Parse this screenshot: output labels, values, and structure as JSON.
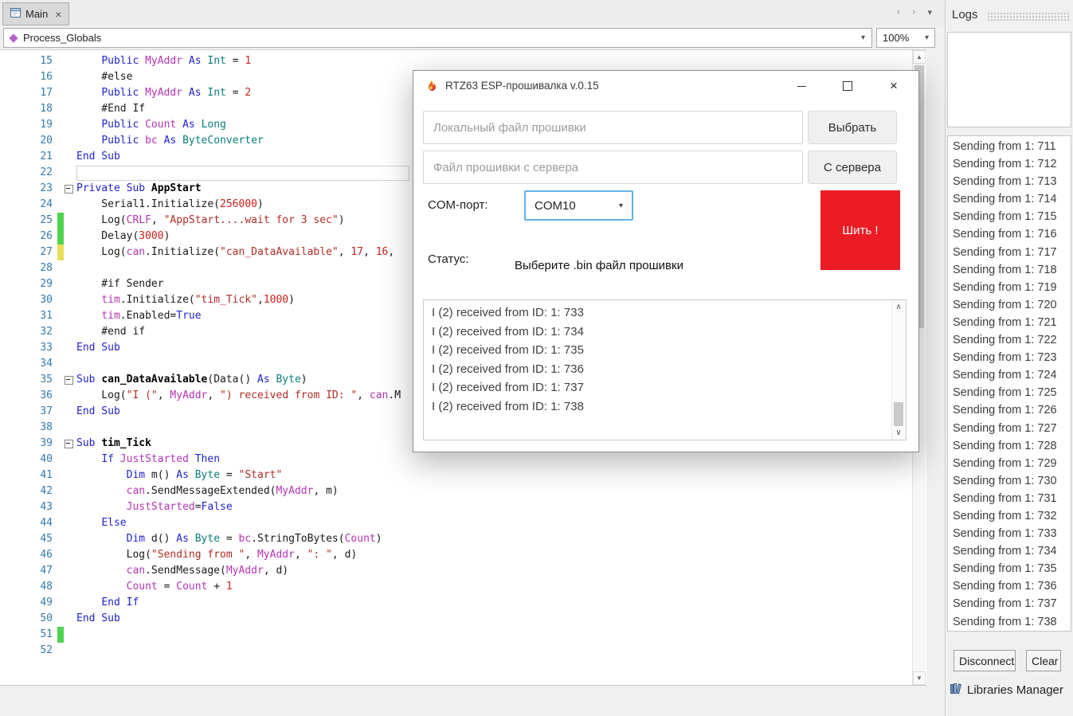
{
  "tab_bar": {
    "tab_label": "Main"
  },
  "toolbar": {
    "module_selector": "Process_Globals",
    "zoom": "100%"
  },
  "icons": {
    "tab_close": "×",
    "nav_left": "‹",
    "nav_right": "›",
    "nav_menu": "▾",
    "chevron_down": "▾",
    "scroll_up": "▲",
    "scroll_down": "▼",
    "list_up": "∧",
    "list_down": "∨",
    "dialog_close": "×"
  },
  "editor": {
    "lines": [
      {
        "n": 15,
        "seg": [
          [
            "    ",
            "p"
          ],
          [
            "Public",
            "k"
          ],
          [
            " ",
            "p"
          ],
          [
            "MyAddr",
            "m"
          ],
          [
            " ",
            "p"
          ],
          [
            "As",
            "k"
          ],
          [
            " ",
            "p"
          ],
          [
            "Int",
            "t"
          ],
          [
            " = ",
            "p"
          ],
          [
            "1",
            "n"
          ]
        ]
      },
      {
        "n": 16,
        "seg": [
          [
            "    #else",
            "p"
          ]
        ]
      },
      {
        "n": 17,
        "seg": [
          [
            "    ",
            "p"
          ],
          [
            "Public",
            "k"
          ],
          [
            " ",
            "p"
          ],
          [
            "MyAddr",
            "m"
          ],
          [
            " ",
            "p"
          ],
          [
            "As",
            "k"
          ],
          [
            " ",
            "p"
          ],
          [
            "Int",
            "t"
          ],
          [
            " = ",
            "p"
          ],
          [
            "2",
            "n"
          ]
        ]
      },
      {
        "n": 18,
        "seg": [
          [
            "    #End If",
            "p"
          ]
        ]
      },
      {
        "n": 19,
        "seg": [
          [
            "    ",
            "p"
          ],
          [
            "Public",
            "k"
          ],
          [
            " ",
            "p"
          ],
          [
            "Count",
            "m"
          ],
          [
            " ",
            "p"
          ],
          [
            "As",
            "k"
          ],
          [
            " ",
            "p"
          ],
          [
            "Long",
            "t"
          ]
        ]
      },
      {
        "n": 20,
        "seg": [
          [
            "    ",
            "p"
          ],
          [
            "Public",
            "k"
          ],
          [
            " ",
            "p"
          ],
          [
            "bc",
            "m"
          ],
          [
            " ",
            "p"
          ],
          [
            "As",
            "k"
          ],
          [
            " ",
            "p"
          ],
          [
            "ByteConverter",
            "t"
          ]
        ]
      },
      {
        "n": 21,
        "seg": [
          [
            "End Sub",
            "k"
          ]
        ]
      },
      {
        "n": 22,
        "active": true,
        "seg": []
      },
      {
        "n": 23,
        "fold": true,
        "seg": [
          [
            "Private Sub",
            "k"
          ],
          [
            " ",
            "p"
          ],
          [
            "AppStart",
            "b"
          ]
        ]
      },
      {
        "n": 24,
        "seg": [
          [
            "    Serial1.Initialize(",
            "p"
          ],
          [
            "256000",
            "n"
          ],
          [
            ")",
            "p"
          ]
        ]
      },
      {
        "n": 25,
        "mark": "g",
        "seg": [
          [
            "    Log(",
            "p"
          ],
          [
            "CRLF",
            "m"
          ],
          [
            ", ",
            "p"
          ],
          [
            "\"AppStart....wait for 3 sec\"",
            "s"
          ],
          [
            ")",
            "p"
          ]
        ]
      },
      {
        "n": 26,
        "mark": "g",
        "seg": [
          [
            "    Delay(",
            "p"
          ],
          [
            "3000",
            "n"
          ],
          [
            ")",
            "p"
          ]
        ]
      },
      {
        "n": 27,
        "mark": "y",
        "seg": [
          [
            "    Log(",
            "p"
          ],
          [
            "can",
            "m"
          ],
          [
            ".Initialize(",
            "p"
          ],
          [
            "\"can_DataAvailable\"",
            "s"
          ],
          [
            ", ",
            "p"
          ],
          [
            "17",
            "n"
          ],
          [
            ", ",
            "p"
          ],
          [
            "16",
            "n"
          ],
          [
            ", ",
            "p"
          ]
        ]
      },
      {
        "n": 28,
        "seg": []
      },
      {
        "n": 29,
        "seg": [
          [
            "    #if Sender",
            "p"
          ]
        ]
      },
      {
        "n": 30,
        "seg": [
          [
            "    ",
            "p"
          ],
          [
            "tim",
            "m"
          ],
          [
            ".Initialize(",
            "p"
          ],
          [
            "\"tim_Tick\"",
            "s"
          ],
          [
            ",",
            "p"
          ],
          [
            "1000",
            "n"
          ],
          [
            ")",
            "p"
          ]
        ]
      },
      {
        "n": 31,
        "seg": [
          [
            "    ",
            "p"
          ],
          [
            "tim",
            "m"
          ],
          [
            ".Enabled=",
            "p"
          ],
          [
            "True",
            "k"
          ]
        ]
      },
      {
        "n": 32,
        "seg": [
          [
            "    #end if",
            "p"
          ]
        ]
      },
      {
        "n": 33,
        "seg": [
          [
            "End Sub",
            "k"
          ]
        ]
      },
      {
        "n": 34,
        "seg": []
      },
      {
        "n": 35,
        "fold": true,
        "seg": [
          [
            "Sub",
            "k"
          ],
          [
            " ",
            "p"
          ],
          [
            "can_DataAvailable",
            "b"
          ],
          [
            "(Data() ",
            "p"
          ],
          [
            "As",
            "k"
          ],
          [
            " ",
            "p"
          ],
          [
            "Byte",
            "t"
          ],
          [
            ")",
            "p"
          ]
        ]
      },
      {
        "n": 36,
        "seg": [
          [
            "    Log(",
            "p"
          ],
          [
            "\"I (\"",
            "s"
          ],
          [
            ", ",
            "p"
          ],
          [
            "MyAddr",
            "m"
          ],
          [
            ", ",
            "p"
          ],
          [
            "\") received from ID: \"",
            "s"
          ],
          [
            ", ",
            "p"
          ],
          [
            "can",
            "m"
          ],
          [
            ".M",
            "p"
          ]
        ]
      },
      {
        "n": 37,
        "seg": [
          [
            "End Sub",
            "k"
          ]
        ]
      },
      {
        "n": 38,
        "seg": []
      },
      {
        "n": 39,
        "fold": true,
        "seg": [
          [
            "Sub",
            "k"
          ],
          [
            " ",
            "p"
          ],
          [
            "tim_Tick",
            "b"
          ]
        ]
      },
      {
        "n": 40,
        "seg": [
          [
            "    ",
            "p"
          ],
          [
            "If",
            "k"
          ],
          [
            " ",
            "p"
          ],
          [
            "JustStarted",
            "m"
          ],
          [
            " ",
            "p"
          ],
          [
            "Then",
            "k"
          ]
        ]
      },
      {
        "n": 41,
        "seg": [
          [
            "        ",
            "p"
          ],
          [
            "Dim",
            "k"
          ],
          [
            " m() ",
            "p"
          ],
          [
            "As",
            "k"
          ],
          [
            " ",
            "p"
          ],
          [
            "Byte",
            "t"
          ],
          [
            " = ",
            "p"
          ],
          [
            "\"Start\"",
            "s"
          ]
        ]
      },
      {
        "n": 42,
        "seg": [
          [
            "        ",
            "p"
          ],
          [
            "can",
            "m"
          ],
          [
            ".SendMessageExtended(",
            "p"
          ],
          [
            "MyAddr",
            "m"
          ],
          [
            ", m)",
            "p"
          ]
        ]
      },
      {
        "n": 43,
        "seg": [
          [
            "        ",
            "p"
          ],
          [
            "JustStarted",
            "m"
          ],
          [
            "=",
            "p"
          ],
          [
            "False",
            "k"
          ]
        ]
      },
      {
        "n": 44,
        "seg": [
          [
            "    ",
            "p"
          ],
          [
            "Else",
            "k"
          ]
        ]
      },
      {
        "n": 45,
        "seg": [
          [
            "        ",
            "p"
          ],
          [
            "Dim",
            "k"
          ],
          [
            " d() ",
            "p"
          ],
          [
            "As",
            "k"
          ],
          [
            " ",
            "p"
          ],
          [
            "Byte",
            "t"
          ],
          [
            " = ",
            "p"
          ],
          [
            "bc",
            "m"
          ],
          [
            ".StringToBytes(",
            "p"
          ],
          [
            "Count",
            "m"
          ],
          [
            ")",
            "p"
          ]
        ]
      },
      {
        "n": 46,
        "seg": [
          [
            "        Log(",
            "p"
          ],
          [
            "\"Sending from \"",
            "s"
          ],
          [
            ", ",
            "p"
          ],
          [
            "MyAddr",
            "m"
          ],
          [
            ", ",
            "p"
          ],
          [
            "\": \"",
            "s"
          ],
          [
            ", d)",
            "p"
          ]
        ]
      },
      {
        "n": 47,
        "seg": [
          [
            "        ",
            "p"
          ],
          [
            "can",
            "m"
          ],
          [
            ".SendMessage(",
            "p"
          ],
          [
            "MyAddr",
            "m"
          ],
          [
            ", d)",
            "p"
          ]
        ]
      },
      {
        "n": 48,
        "seg": [
          [
            "        ",
            "p"
          ],
          [
            "Count",
            "m"
          ],
          [
            " = ",
            "p"
          ],
          [
            "Count",
            "m"
          ],
          [
            " + ",
            "p"
          ],
          [
            "1",
            "n"
          ]
        ]
      },
      {
        "n": 49,
        "seg": [
          [
            "    ",
            "p"
          ],
          [
            "End If",
            "k"
          ]
        ]
      },
      {
        "n": 50,
        "seg": [
          [
            "End Sub",
            "k"
          ]
        ]
      },
      {
        "n": 51,
        "mark": "g",
        "seg": []
      },
      {
        "n": 52,
        "seg": []
      }
    ]
  },
  "dialog": {
    "title": "RTZ63 ESP-прошивалка v.0.15",
    "local_file": {
      "placeholder": "Локальный файл прошивки",
      "value": "",
      "button": "Выбрать"
    },
    "server_file": {
      "placeholder": "Файл прошивки с сервера",
      "value": "",
      "button": "С сервера"
    },
    "com_port": {
      "label": "COM-порт:",
      "value": "COM10"
    },
    "flash_button": "Шить !",
    "status": {
      "label": "Статус:",
      "text": "Выберите .bin файл прошивки"
    },
    "listbox": {
      "items": [
        "I (2) received from ID: 1: 733",
        "I (2) received from ID: 1: 734",
        "I (2) received from ID: 1: 735",
        "I (2) received from ID: 1: 736",
        "I (2) received from ID: 1: 737",
        "I (2) received from ID: 1: 738"
      ]
    }
  },
  "logs": {
    "title": "Logs",
    "items": [
      "Sending from 1: 711",
      "Sending from 1: 712",
      "Sending from 1: 713",
      "Sending from 1: 714",
      "Sending from 1: 715",
      "Sending from 1: 716",
      "Sending from 1: 717",
      "Sending from 1: 718",
      "Sending from 1: 719",
      "Sending from 1: 720",
      "Sending from 1: 721",
      "Sending from 1: 722",
      "Sending from 1: 723",
      "Sending from 1: 724",
      "Sending from 1: 725",
      "Sending from 1: 726",
      "Sending from 1: 727",
      "Sending from 1: 728",
      "Sending from 1: 729",
      "Sending from 1: 730",
      "Sending from 1: 731",
      "Sending from 1: 732",
      "Sending from 1: 733",
      "Sending from 1: 734",
      "Sending from 1: 735",
      "Sending from 1: 736",
      "Sending from 1: 737",
      "Sending from 1: 738"
    ],
    "disconnect_button": "Disconnect",
    "clear_button": "Clear"
  },
  "footer": {
    "libraries_manager": "Libraries Manager"
  }
}
